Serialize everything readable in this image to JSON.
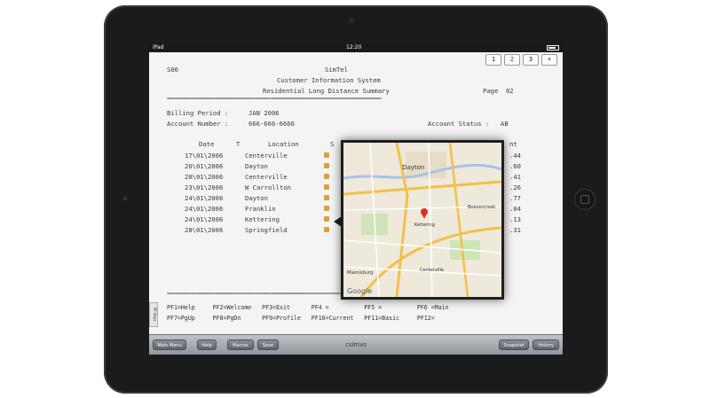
{
  "status_bar": {
    "carrier": "iPad",
    "time": "12:20"
  },
  "page_buttons": [
    "1",
    "2",
    "3",
    "+"
  ],
  "terminal": {
    "header_code": "S06",
    "company": "SimTel",
    "system": "Customer Information System",
    "report": "Residential Long Distance Summary",
    "page_label": "Page  02",
    "separator": "================================================================================",
    "billing_label": "Billing Period :",
    "billing_value": "JAN 2006",
    "account_label": "Account Number :",
    "account_value": "666-666-6666",
    "status_label": "Account Status :",
    "status_value": "AB",
    "columns": [
      "Date",
      "T",
      "Location"
    ],
    "rows": [
      {
        "date": "17\\01\\2006",
        "location": "Centerville",
        "amount": ".44"
      },
      {
        "date": "20\\01\\2006",
        "location": "Dayton",
        "amount": ".60"
      },
      {
        "date": "20\\01\\2006",
        "location": "Centerville",
        "amount": ".41"
      },
      {
        "date": "23\\01\\2006",
        "location": "W Carrollton",
        "amount": ".26"
      },
      {
        "date": "24\\01\\2006",
        "location": "Dayton",
        "amount": ".77"
      },
      {
        "date": "24\\01\\2006",
        "location": "Franklin",
        "amount": ".04"
      },
      {
        "date": "24\\01\\2006",
        "location": "Kettering",
        "amount": ".13"
      },
      {
        "date": "28\\01\\2006",
        "location": "Springfield",
        "amount": ".31"
      }
    ],
    "col_S": "S",
    "col_nt": "nt",
    "fkeys_row1": "PF1=Help     PF2=Welcome   PF3=Exit      PF4 =          PF5 =          PF6 =Main",
    "fkeys_row2": "PF7=PgUp     PF8=PgDn      PF9=Profile   PF10=Current   PF11=Basic     PF12="
  },
  "side_tab": "PF Keys",
  "map": {
    "labels": {
      "dayton": "Dayton",
      "kettering": "Kettering",
      "centerville": "Centerville",
      "beavercreek": "Beavercreek",
      "miamisburg": "Miamisburg",
      "google": "Google"
    },
    "colors": {
      "road_major": "#f2c04a",
      "road_minor": "#ffffff",
      "water": "#a6c3e8",
      "park": "#cfe4b8",
      "pin": "#d93025"
    }
  },
  "toolbar": {
    "main_menu": "Main Menu",
    "help": "Help",
    "macros": "Macros",
    "save": "Save",
    "title": "csimvs",
    "snapshot": "Snapshot",
    "history": "History"
  }
}
